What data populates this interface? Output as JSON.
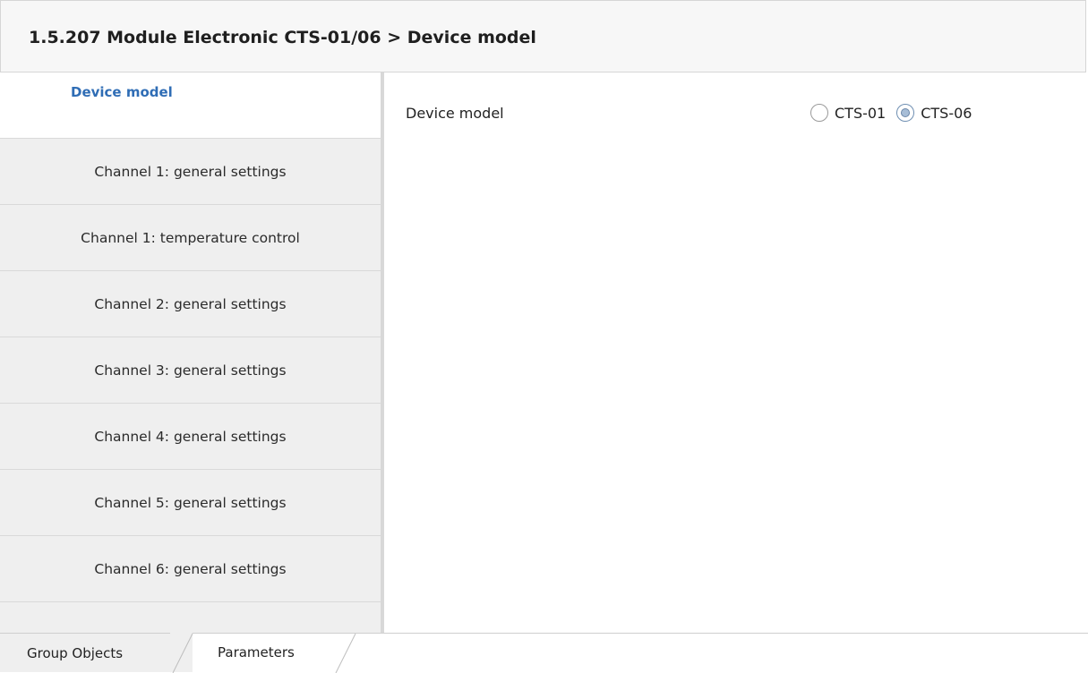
{
  "header": {
    "title": "1.5.207 Module Electronic CTS-01/06 > Device model"
  },
  "sidebar": {
    "items": [
      {
        "label": "Device model",
        "active": true
      },
      {
        "label": "Channel 1: general settings",
        "active": false
      },
      {
        "label": "Channel 1: temperature control",
        "active": false
      },
      {
        "label": "Channel 2: general settings",
        "active": false
      },
      {
        "label": "Channel 3: general settings",
        "active": false
      },
      {
        "label": "Channel 4: general settings",
        "active": false
      },
      {
        "label": "Channel 5: general settings",
        "active": false
      },
      {
        "label": "Channel 6: general settings",
        "active": false
      }
    ]
  },
  "content": {
    "param_label": "Device model",
    "options": [
      {
        "label": "CTS-01",
        "selected": false
      },
      {
        "label": "CTS-06",
        "selected": true
      }
    ]
  },
  "footer": {
    "tabs": [
      {
        "label": "Group Objects",
        "active": false
      },
      {
        "label": "Parameters",
        "active": true
      }
    ]
  },
  "colors": {
    "accent": "#2f6db5",
    "sidebar_bg": "#efefef",
    "header_bg": "#f7f7f7"
  }
}
